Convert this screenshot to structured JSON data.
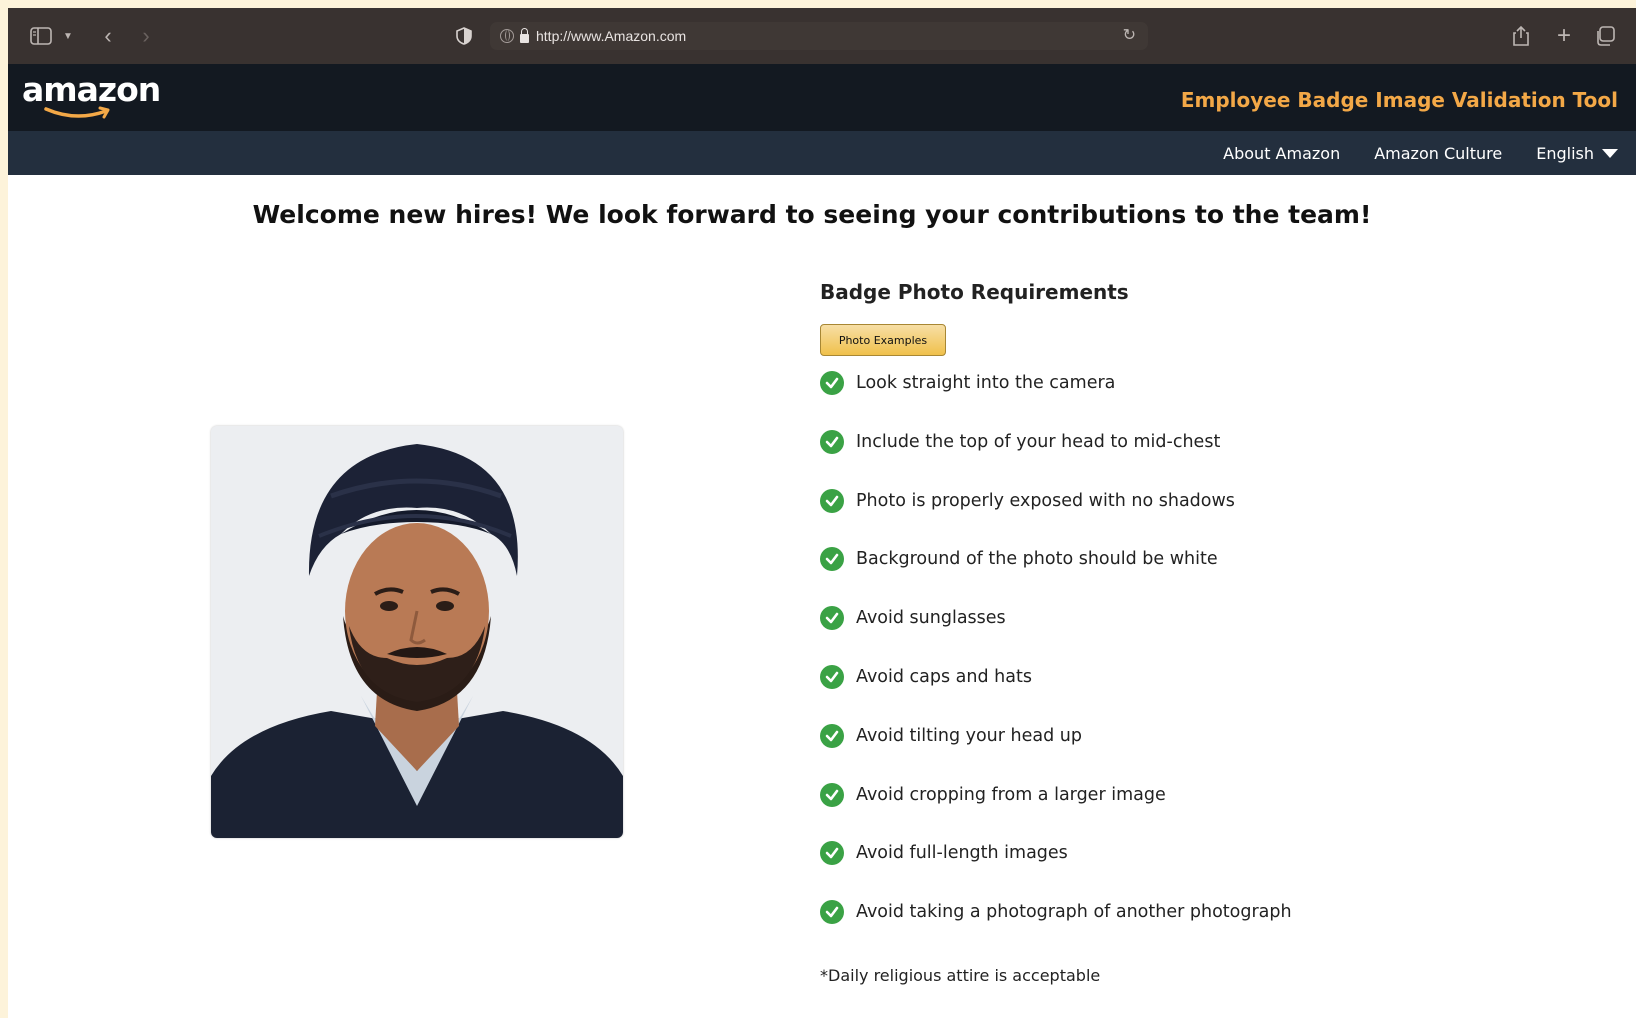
{
  "browser": {
    "url": "http://www.Amazon.com"
  },
  "header": {
    "logo": "amazon",
    "tool_title": "Employee Badge Image Validation Tool"
  },
  "nav": {
    "links": [
      "About Amazon",
      "Amazon Culture"
    ],
    "language": "English"
  },
  "main": {
    "welcome": "Welcome new hires! We look forward to seeing your contributions to the team!",
    "requirements_title": "Badge Photo Requirements",
    "examples_button": "Photo Examples",
    "requirements": [
      "Look straight into the camera",
      "Include the top of your head to mid-chest",
      "Photo is properly exposed with no shadows",
      "Background of the photo should be white",
      "Avoid sunglasses",
      "Avoid caps and hats",
      "Avoid tilting your head up",
      "Avoid cropping from a larger image",
      "Avoid full-length images",
      "Avoid taking a photograph of another photograph"
    ],
    "note": "*Daily religious attire is acceptable"
  },
  "colors": {
    "header_bg": "#131921",
    "nav_bg": "#232f3e",
    "accent": "#f3a847",
    "check": "#3aa245"
  }
}
